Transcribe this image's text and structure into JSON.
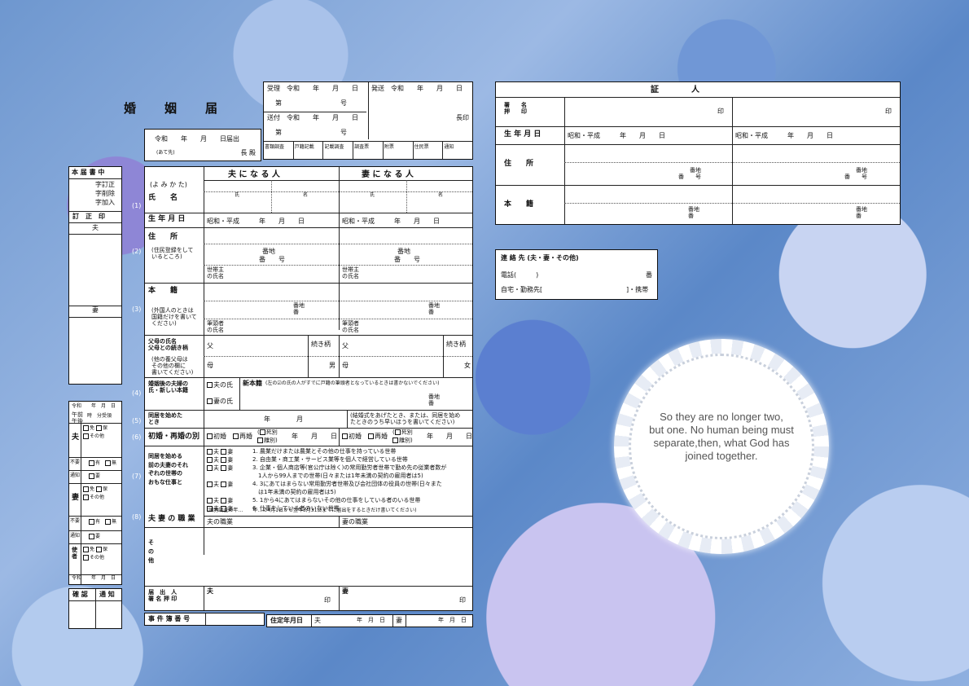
{
  "form_title": "婚　姻　届",
  "reception": {
    "juri": "受理　令和　　年　　月　　日",
    "juri_no": "第　　　　　　　　　号",
    "sofu": "送付　令和　　年　　月　　日",
    "sofu_no": "第　　　　　　　　　号",
    "hasso": "発送　令和　　年　　月　　日",
    "chouin": "長印",
    "checks": [
      "書類調査",
      "戸籍記載",
      "記載調査",
      "調査票",
      "附票",
      "住民票",
      "通知"
    ]
  },
  "submission": {
    "date": "令和　　年　　月　　日届出",
    "addressee": "(あて先)",
    "chief": "長 殿"
  },
  "left_sidebar": {
    "honseki_title": "本 届 書 中",
    "corrections": [
      "字訂正",
      "字削除",
      "字加入"
    ],
    "teisei": "訂　正　印",
    "husband": "夫",
    "wife": "妻"
  },
  "main": {
    "yomikata": "(よ み か た)",
    "husband_head": "夫 に な る 人",
    "wife_head": "妻 に な る 人",
    "name_label": "氏　　名",
    "shi": "氏",
    "mei": "名",
    "birth_label": "生 年 月 日",
    "birth_value": "昭和・平成　　　年　　月　　日",
    "address_label": "住　　所",
    "address_note": "(住民登録をして\nいるところ)",
    "banchi": "番地",
    "ban_go": "番　　号",
    "setainushi": "世帯主\nの氏名",
    "honseki_label": "本　　籍",
    "honseki_note": "(外国人のときは\n国籍だけを書いて\nください)",
    "banchi_ban": "番地\n番",
    "hittousha": "筆頭者\nの氏名",
    "parents_label": "父母の氏名\n父母との続き柄",
    "parents_note": "(他の養父母は\nその他の欄に\n書いてください)",
    "chichi": "父",
    "haha": "母",
    "tsuzukigara": "続き柄",
    "male": "男",
    "female": "女",
    "after_label": "婚姻後の夫婦の\n氏・新しい本籍",
    "husband_name_opt": "夫の氏",
    "wife_name_opt": "妻の氏",
    "new_honseki": "新本籍",
    "new_honseki_note": "(左の☑の氏の人がすでに戸籍の筆頭者となっているときは書かないでください)",
    "cohab_label": "同居を始めた\nとき",
    "cohab_value": "年　　　　月",
    "cohab_note": "(結婚式をあげたとき、または、同居を始め\nたときのうち早いほうを書いてください)",
    "first_label": "初婚・再婚の別",
    "shokon": "初婚",
    "saikon": "再婚",
    "shibetsu": "死別",
    "ribetsu": "離別",
    "ymd": "年　　月　　日",
    "work_label": "同居を始める\n前の夫妻のそれ\nぞれの世帯の\nおもな仕事と",
    "work_items": [
      "1. 農業だけまたは農業とその他の仕事を持っている世帯",
      "2. 自由業・商工業・サービス業等を個人で経営している世帯",
      "3. 企業・個人商店等(官公庁は除く)の常用勤労者世帯で勤め先の従業者数が",
      "　1人から99人までの世帯(日々または1年未満の契約の雇用者は5)",
      "4. 3にあてはまらない常用勤労者世帯及び会社団体の役員の世帯(日々また",
      "　は1年未満の契約の雇用者は5)",
      "5. 1から4にあてはまらないその他の仕事をしている者のいる世帯",
      "6. 仕事をしている者のいない世帯"
    ],
    "occupation_label": "夫 妻 の 職 業",
    "census_note": "(国勢調査の年…　　年…の4月1日から翌年3月31日までに届出をするときだけ書いてください)",
    "husband_job": "夫の職業",
    "wife_job": "妻の職業",
    "other_label": "そ\nの\n他",
    "signer_label": "届　出　人\n署 名 押 印",
    "signer_husband": "夫",
    "signer_wife": "妻",
    "seal": "印",
    "case_no": "事 件 簿 番 号",
    "fixed_date": "住定年月日",
    "fixed_husband": "夫",
    "fixed_wife": "妻",
    "md": "年　月　日"
  },
  "witness": {
    "title": "証　　　　人",
    "sign_label": "署　　名\n押　　印",
    "seal": "印",
    "birth_label": "生 年 月 日",
    "birth_value": "昭和・平成　　　年　　月　　日",
    "address_label": "住　　所",
    "banchi_go": "番地\n番　　号",
    "honseki_label": "本　　籍",
    "banchi_ban": "番地\n番"
  },
  "contact": {
    "title": "連 絡 先 (夫・妻・その他)",
    "phone": "電話(　　　)",
    "ban": "番",
    "home": "自宅・勤務先[",
    "mobile": "]・携帯"
  },
  "sidebar_lower": {
    "date_line": "令和　　年　月　日",
    "ampm": "午前\n午後",
    "time": "時　分受領",
    "husband": "夫",
    "wife": "妻",
    "messenger": "使\n者",
    "options": [
      "免",
      "保",
      "その他"
    ],
    "yes": "有",
    "no": "無",
    "notify": "通知",
    "need": "要",
    "noneed": "不要",
    "kakunin": "確 認",
    "tsuuchi": "通 知"
  },
  "quote": "So they are no longer two,\nbut one. No human being must\nseparate,then, what God has\njoined together."
}
